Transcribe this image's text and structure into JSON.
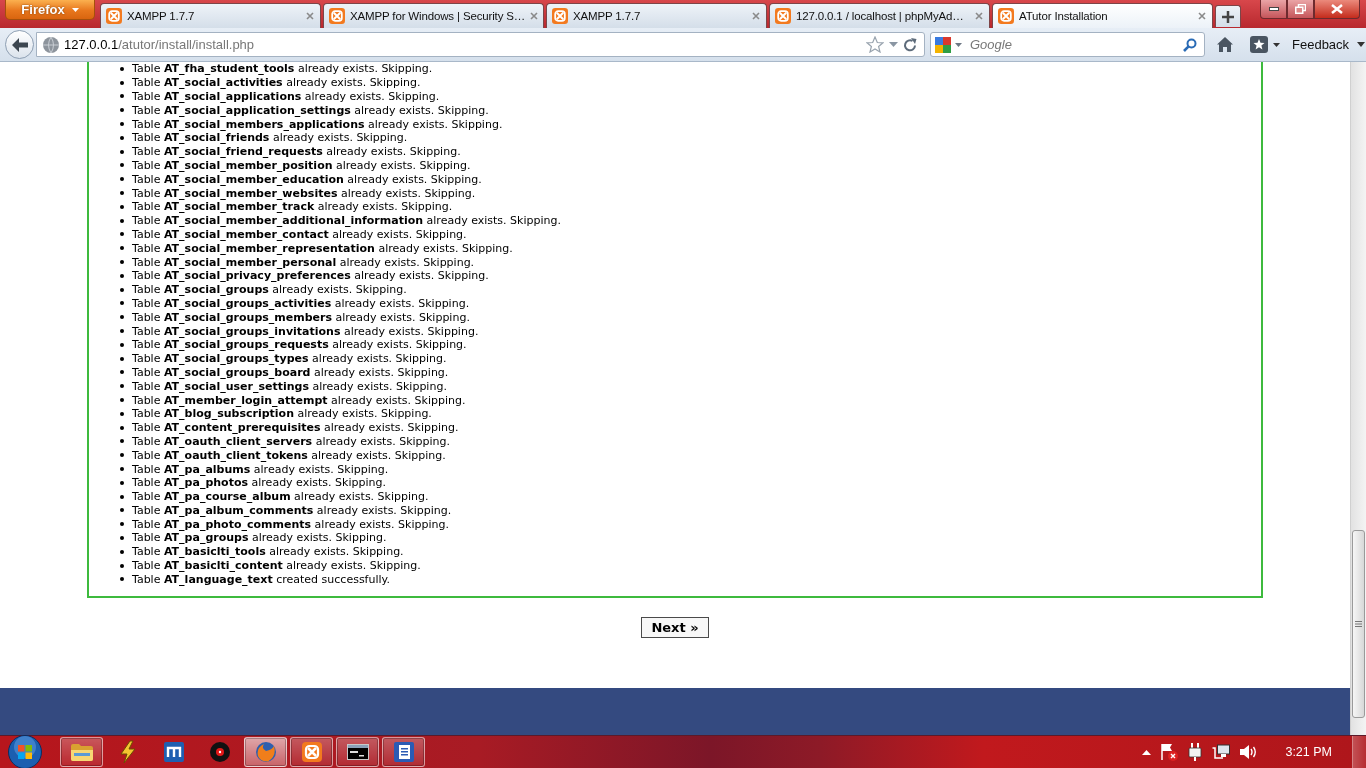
{
  "browser": {
    "menu_button": "Firefox",
    "tabs": [
      {
        "title": "XAMPP 1.7.7",
        "selected": false
      },
      {
        "title": "XAMPP for Windows | Security S…",
        "selected": false
      },
      {
        "title": "XAMPP 1.7.7",
        "selected": false
      },
      {
        "title": "127.0.0.1 / localhost | phpMyAd…",
        "selected": false
      },
      {
        "title": "ATutor Installation",
        "selected": true
      }
    ],
    "address": {
      "host": "127.0.0.1",
      "path": "/atutor/install/install.php"
    },
    "search": {
      "placeholder": "Google"
    },
    "feedback_button": "Feedback"
  },
  "page": {
    "results": [
      "Table **AT_fha_student_tools** already exists. Skipping.",
      "Table **AT_social_activities** already exists. Skipping.",
      "Table **AT_social_applications** already exists. Skipping.",
      "Table **AT_social_application_settings** already exists. Skipping.",
      "Table **AT_social_members_applications** already exists. Skipping.",
      "Table **AT_social_friends** already exists. Skipping.",
      "Table **AT_social_friend_requests** already exists. Skipping.",
      "Table **AT_social_member_position** already exists. Skipping.",
      "Table **AT_social_member_education** already exists. Skipping.",
      "Table **AT_social_member_websites** already exists. Skipping.",
      "Table **AT_social_member_track** already exists. Skipping.",
      "Table **AT_social_member_additional_information** already exists. Skipping.",
      "Table **AT_social_member_contact** already exists. Skipping.",
      "Table **AT_social_member_representation** already exists. Skipping.",
      "Table **AT_social_member_personal** already exists. Skipping.",
      "Table **AT_social_privacy_preferences** already exists. Skipping.",
      "Table **AT_social_groups** already exists. Skipping.",
      "Table **AT_social_groups_activities** already exists. Skipping.",
      "Table **AT_social_groups_members** already exists. Skipping.",
      "Table **AT_social_groups_invitations** already exists. Skipping.",
      "Table **AT_social_groups_requests** already exists. Skipping.",
      "Table **AT_social_groups_types** already exists. Skipping.",
      "Table **AT_social_groups_board** already exists. Skipping.",
      "Table **AT_social_user_settings** already exists. Skipping.",
      "Table **AT_member_login_attempt** already exists. Skipping.",
      "Table **AT_blog_subscription** already exists. Skipping.",
      "Table **AT_content_prerequisites** already exists. Skipping.",
      "Table **AT_oauth_client_servers** already exists. Skipping.",
      "Table **AT_oauth_client_tokens** already exists. Skipping.",
      "Table **AT_pa_albums** already exists. Skipping.",
      "Table **AT_pa_photos** already exists. Skipping.",
      "Table **AT_pa_course_album** already exists. Skipping.",
      "Table **AT_pa_album_comments** already exists. Skipping.",
      "Table **AT_pa_photo_comments** already exists. Skipping.",
      "Table **AT_pa_groups** already exists. Skipping.",
      "Table **AT_basiclti_tools** already exists. Skipping.",
      "Table **AT_basiclti_content** already exists. Skipping.",
      "Table **AT_language_text** created successfully."
    ],
    "next_button": "Next »"
  },
  "taskbar": {
    "apps": [
      {
        "kind": "folder",
        "running": true,
        "selected": false
      },
      {
        "kind": "bolt",
        "running": false,
        "selected": false
      },
      {
        "kind": "tile",
        "running": false,
        "selected": false
      },
      {
        "kind": "disc",
        "running": false,
        "selected": false
      },
      {
        "kind": "browser",
        "running": true,
        "selected": true
      },
      {
        "kind": "xampp",
        "running": true,
        "selected": false
      },
      {
        "kind": "terminal",
        "running": true,
        "selected": false
      },
      {
        "kind": "writer",
        "running": true,
        "selected": false
      }
    ],
    "clock": "3:21 PM"
  }
}
